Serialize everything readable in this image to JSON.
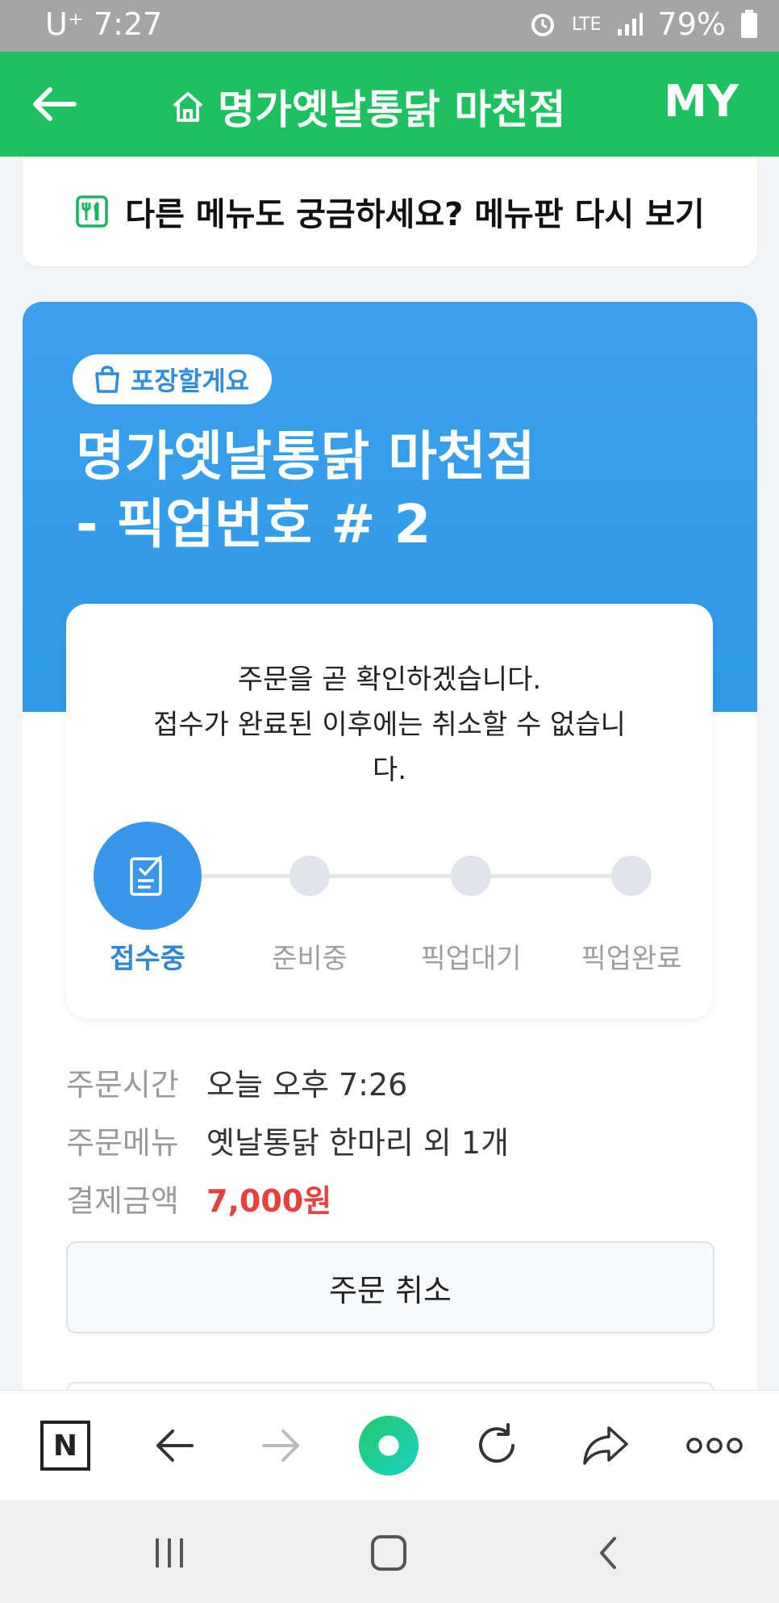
{
  "status_bar": {
    "carrier": "U⁺",
    "time": "7:27",
    "network": "LTE",
    "battery": "79%"
  },
  "app_bar": {
    "title": "명가옛날통닭 마천점",
    "my_label": "MY"
  },
  "menu_link": {
    "text": "다른 메뉴도 궁금하세요? 메뉴판 다시 보기"
  },
  "order": {
    "badge": "포장할게요",
    "store_name": "명가옛날통닭 마천점",
    "pickup_line": "- 픽업번호 # 2",
    "status_message_line1": "주문을 곧 확인하겠습니다.",
    "status_message_line2": "접수가 완료된 이후에는 취소할 수 없습니",
    "status_message_line3": "다.",
    "steps": [
      {
        "label": "접수중",
        "active": true
      },
      {
        "label": "준비중",
        "active": false
      },
      {
        "label": "픽업대기",
        "active": false
      },
      {
        "label": "픽업완료",
        "active": false
      }
    ],
    "info": {
      "time_label": "주문시간",
      "time_value": "오늘 오후 7:26",
      "menu_label": "주문메뉴",
      "menu_value": "옛날통닭 한마리 외 1개",
      "amount_label": "결제금액",
      "amount_value": "7,000원"
    },
    "cancel_button": "주문 취소"
  },
  "colors": {
    "app_bar": "#1dc160",
    "header_blue": "#3ba0ee",
    "active_step": "#3896ec",
    "price": "#e4413f",
    "browser_home": "#19d1a4"
  },
  "browser_toolbar": {
    "icons": [
      "naver-icon",
      "back-arrow-icon",
      "forward-arrow-icon",
      "green-dot-icon",
      "refresh-icon",
      "share-icon",
      "more-icon"
    ],
    "naver_label": "N"
  },
  "system_nav": {
    "icons": [
      "recent-apps-icon",
      "home-icon",
      "back-icon"
    ]
  }
}
